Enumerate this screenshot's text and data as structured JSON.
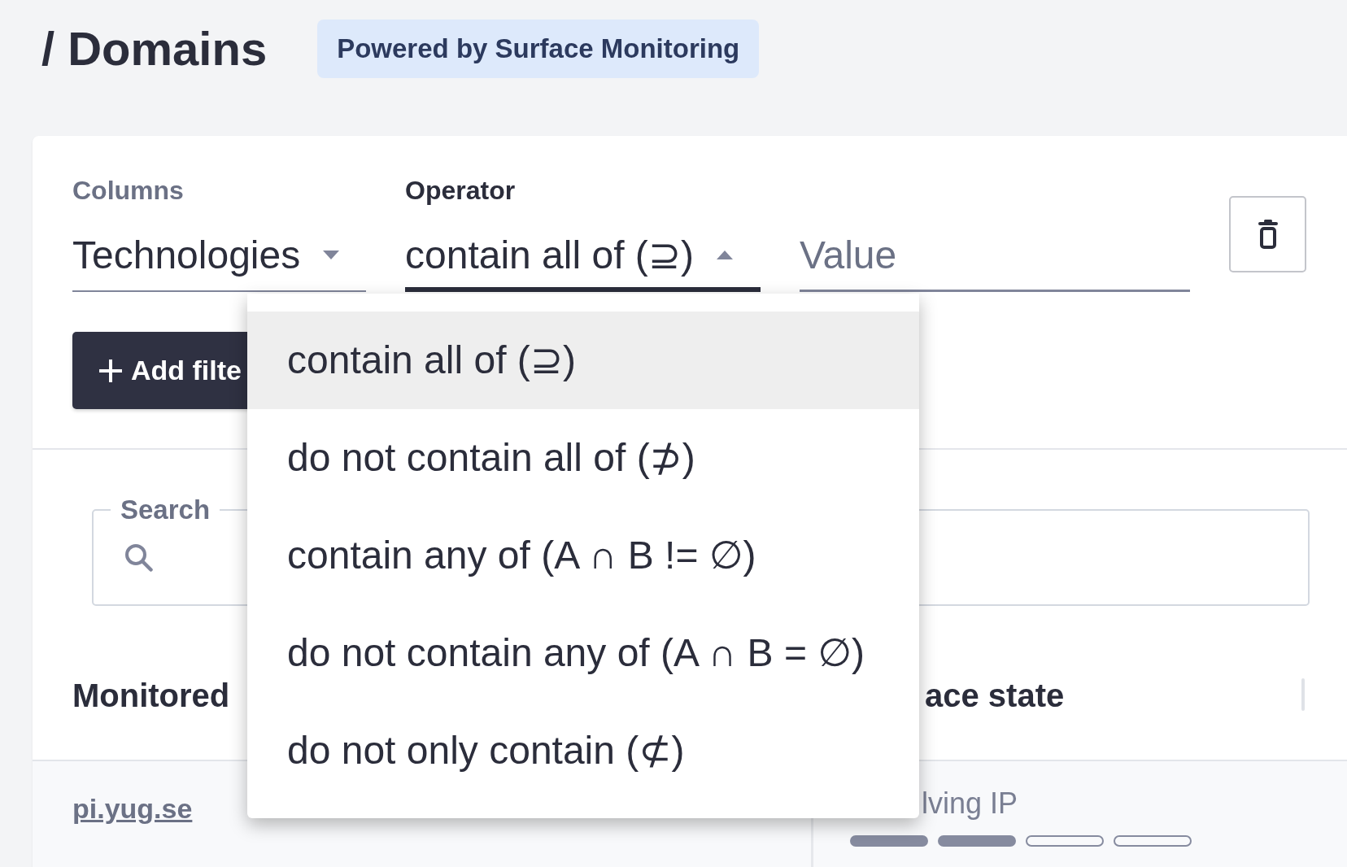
{
  "page": {
    "title": "/ Domains",
    "badge": "Powered by Surface Monitoring"
  },
  "filter": {
    "columns": {
      "label": "Columns",
      "value": "Technologies",
      "open": false
    },
    "operator": {
      "label": "Operator",
      "value": "contain all of (⊇)",
      "open": true
    },
    "value": {
      "placeholder": "Value"
    },
    "add_button": {
      "label": "Add filte"
    }
  },
  "operator_menu": {
    "options": [
      {
        "label": "contain all of (⊇)",
        "selected": true
      },
      {
        "label": "do not contain all of (⊅)",
        "selected": false
      },
      {
        "label": "contain any of (A ∩ B != ∅)",
        "selected": false
      },
      {
        "label": "do not contain any of (A ∩ B = ∅)",
        "selected": false
      },
      {
        "label": "do not only contain (⊄)",
        "selected": false
      }
    ]
  },
  "search": {
    "label": "Search"
  },
  "table": {
    "columns": [
      "Monitored",
      "ace state"
    ],
    "rows": [
      {
        "domain": "pi.yug.se",
        "state": "lving IP",
        "level": 0.5
      }
    ]
  }
}
